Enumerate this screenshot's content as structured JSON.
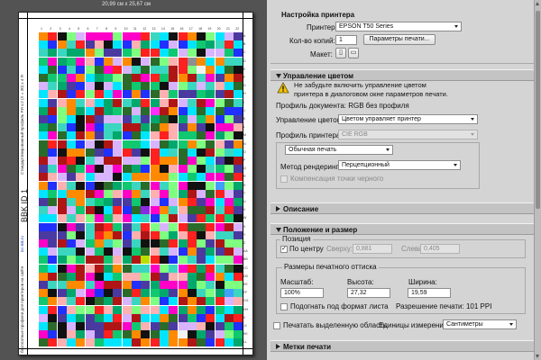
{
  "preview": {
    "dimensions_label": "20,99 см x 25,67 см",
    "side_text_top": "Стандартизированный профиль РИ v.2 (Х = 30) х 4 Я",
    "side_text_bottom": "бесплатные профили для принтеров на сайте",
    "side_link": "icc-ink.ru",
    "side_code": "BBK ID 1",
    "column_numbers": [
      "1",
      "2",
      "3",
      "4",
      "5",
      "6",
      "7",
      "8",
      "9",
      "10",
      "11",
      "12",
      "13",
      "14",
      "15",
      "16",
      "17",
      "18",
      "19",
      "20",
      "21",
      "22"
    ],
    "row_numbers": [
      "A",
      "B",
      "C",
      "D",
      "E",
      "F",
      "G",
      "H",
      "I",
      "J",
      "K",
      "L",
      "M",
      "N",
      "O",
      "P",
      "Q",
      "R",
      "S",
      "T",
      "U",
      "V",
      "W",
      "X",
      "Y",
      "Z",
      "AA",
      "BB",
      "CC",
      "DD",
      "EE",
      "FF",
      "GG",
      "HH",
      "II",
      "JJ",
      "KK",
      "LL"
    ],
    "palette": [
      "#ff2020",
      "#1fd31f",
      "#2030ff",
      "#ff30ff",
      "#00e5ff",
      "#ffee00",
      "#ff8a00",
      "#8a2be2",
      "#00a86b",
      "#ff69b4",
      "#111111",
      "#f2f2f2",
      "#7fff7f",
      "#3fa0ff",
      "#b01515",
      "#b7e000",
      "#2a6b2a",
      "#ff4fa0",
      "#3bd6c0",
      "#9b6bff",
      "#d8b4ff",
      "#c8a060",
      "#10c870",
      "#8f8f8f",
      "#ffb0b0",
      "#a0d0ff",
      "#ff00c8",
      "#00ff9c",
      "#4a3aa0",
      "#e0ff70"
    ]
  },
  "printer_setup": {
    "header": "Настройка принтера",
    "printer_label": "Принтер:",
    "printer_value": "EPSON T50 Series",
    "copies_label": "Кол-во копий:",
    "copies_value": "1",
    "settings_button": "Параметры печати...",
    "layout_label": "Макет:"
  },
  "color_management": {
    "header": "Управление цветом",
    "warning_line1": "Не забудьте включить управление цветом",
    "warning_line2": "принтера в диалоговом окне параметров печати.",
    "doc_profile": "Профиль документа: RGB без профиля",
    "color_handling_label": "Управление цветом:",
    "color_handling_value": "Цветом управляет принтер",
    "printer_profile_label": "Профиль принтера:",
    "printer_profile_value": "CIE RGB",
    "normal_print_value": "Обычная печать",
    "rendering_label": "Метод рендеринга:",
    "rendering_value": "Перцепционный",
    "bpc_label": "Компенсация точки черного"
  },
  "description": {
    "header": "Описание"
  },
  "position_size": {
    "header": "Положение и размер",
    "position_group": "Позиция",
    "center_label": "По центру",
    "top_label": "Сверху:",
    "top_value": "0,881",
    "left_label": "Слева:",
    "left_value": "0,405",
    "scaled_group": "Размеры печатного оттиска",
    "scale_label": "Масштаб:",
    "scale_value": "100%",
    "height_label": "Высота:",
    "height_value": "27,32",
    "width_label": "Ширина:",
    "width_value": "19,59",
    "fit_label": "Подогнать под формат листа",
    "resolution": "Разрешение печати: 101 PPI",
    "print_selected_label": "Печатать выделенную область",
    "units_label": "Единицы измерения:",
    "units_value": "Сантиметры"
  },
  "print_marks": {
    "header": "Метки печати"
  }
}
